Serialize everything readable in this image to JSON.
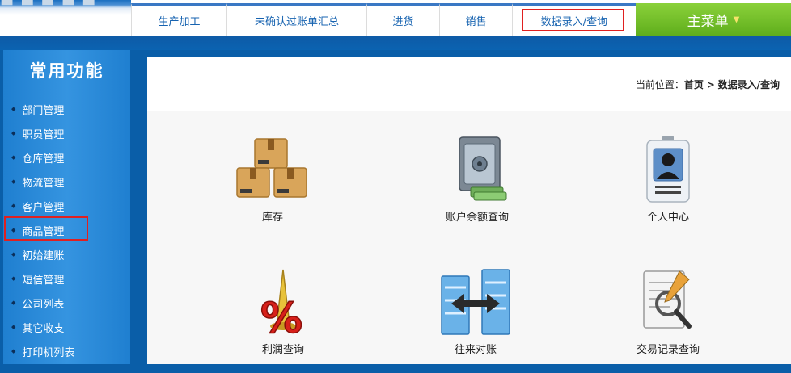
{
  "nav": {
    "items": [
      "生产加工",
      "未确认过账单汇总",
      "进货",
      "销售",
      "数据录入/查询"
    ],
    "main_menu": "主菜单"
  },
  "sidebar": {
    "title": "常用功能",
    "items": [
      "部门管理",
      "职员管理",
      "仓库管理",
      "物流管理",
      "客户管理",
      "商品管理",
      "初始建账",
      "短信管理",
      "公司列表",
      "其它收支",
      "打印机列表"
    ]
  },
  "breadcrumb": {
    "prefix": "当前位置：",
    "home": "首页",
    "sep": ">",
    "current": "数据录入/查询"
  },
  "tiles": [
    {
      "label": "库存",
      "icon": "boxes-icon"
    },
    {
      "label": "账户余额查询",
      "icon": "safe-icon"
    },
    {
      "label": "个人中心",
      "icon": "id-badge-icon"
    },
    {
      "label": "利润查询",
      "icon": "percent-icon"
    },
    {
      "label": "往来对账",
      "icon": "server-exchange-icon"
    },
    {
      "label": "交易记录查询",
      "icon": "document-search-icon"
    }
  ],
  "colors": {
    "accent_blue": "#0a5ea8",
    "nav_text": "#1763b0",
    "main_menu_green": "#6cbf25",
    "highlight_red": "#e02020"
  }
}
